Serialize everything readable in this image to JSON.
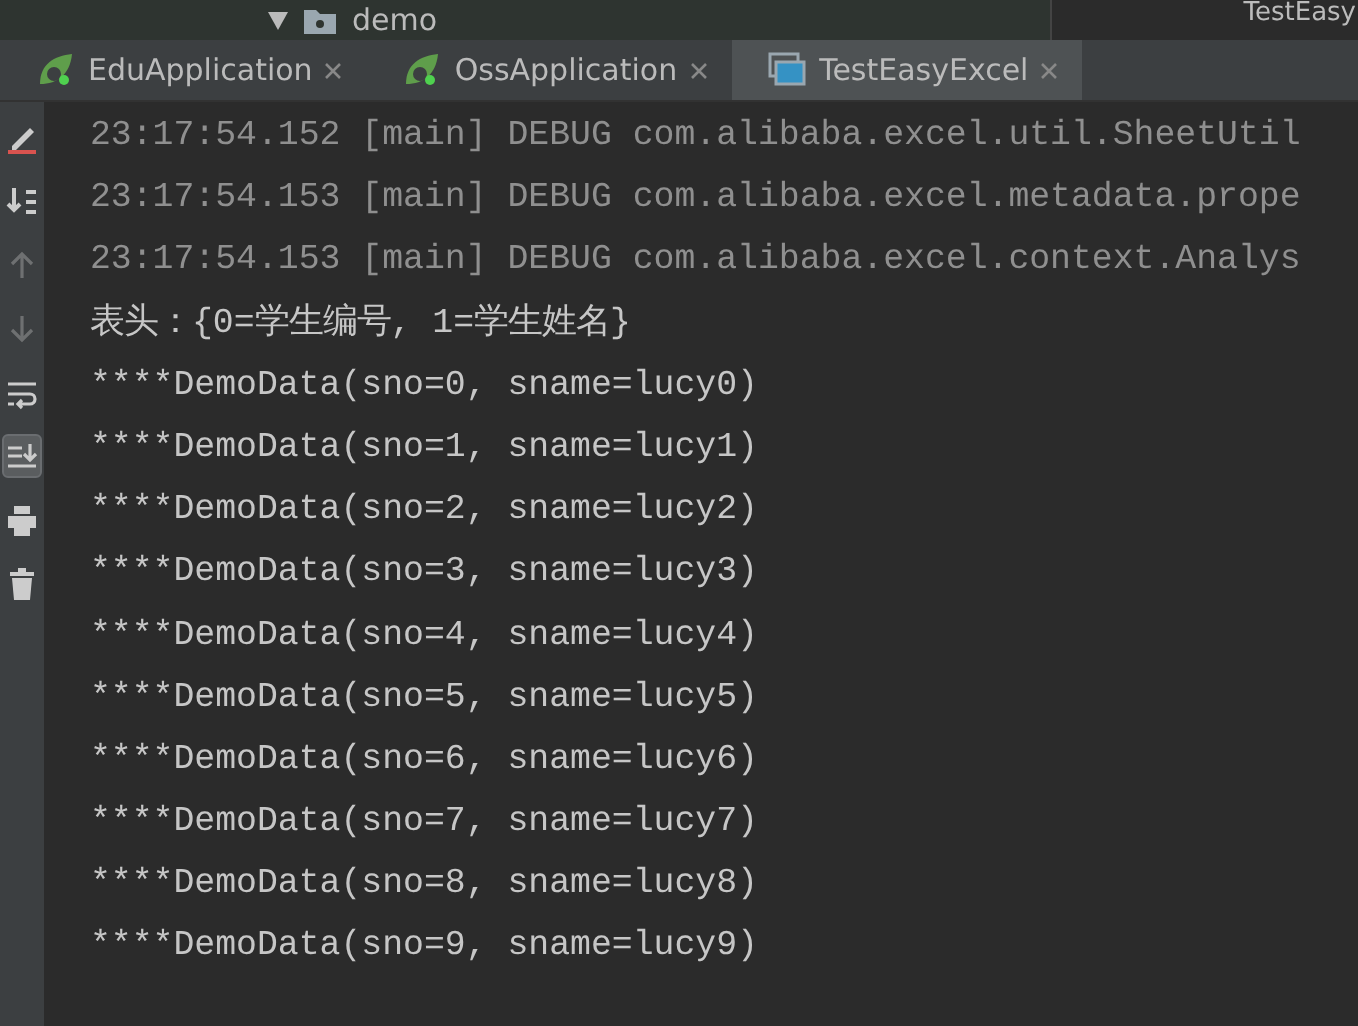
{
  "project_tree": {
    "folder": "demo",
    "expanded": true
  },
  "top_right_title": "TestEasy",
  "tabs": [
    {
      "label": "EduApplication",
      "kind": "spring",
      "selected": false
    },
    {
      "label": "OssApplication",
      "kind": "spring",
      "selected": false
    },
    {
      "label": "TestEasyExcel",
      "kind": "window",
      "selected": true
    }
  ],
  "toolbar": [
    {
      "kind": "edit",
      "selected": false,
      "disabled": false
    },
    {
      "kind": "sort",
      "selected": false,
      "disabled": false
    },
    {
      "kind": "up",
      "selected": false,
      "disabled": true
    },
    {
      "kind": "down",
      "selected": false,
      "disabled": true
    },
    {
      "kind": "wrap",
      "selected": false,
      "disabled": false
    },
    {
      "kind": "scroll-end",
      "selected": true,
      "disabled": false
    },
    {
      "kind": "print",
      "selected": false,
      "disabled": false
    },
    {
      "kind": "trash",
      "selected": false,
      "disabled": false
    }
  ],
  "console_lines": [
    {
      "kind": "log",
      "text": "23:17:54.152 [main] DEBUG com.alibaba.excel.util.SheetUtil"
    },
    {
      "kind": "log",
      "text": "23:17:54.153 [main] DEBUG com.alibaba.excel.metadata.prope"
    },
    {
      "kind": "log",
      "text": "23:17:54.153 [main] DEBUG com.alibaba.excel.context.Analys"
    },
    {
      "kind": "output",
      "text": "表头：{0=学生编号, 1=学生姓名}"
    },
    {
      "kind": "output",
      "text": "****DemoData(sno=0, sname=lucy0)"
    },
    {
      "kind": "output",
      "text": "****DemoData(sno=1, sname=lucy1)"
    },
    {
      "kind": "output",
      "text": "****DemoData(sno=2, sname=lucy2)"
    },
    {
      "kind": "output",
      "text": "****DemoData(sno=3, sname=lucy3)"
    },
    {
      "kind": "output",
      "text": "****DemoData(sno=4, sname=lucy4)"
    },
    {
      "kind": "output",
      "text": "****DemoData(sno=5, sname=lucy5)"
    },
    {
      "kind": "output",
      "text": "****DemoData(sno=6, sname=lucy6)"
    },
    {
      "kind": "output",
      "text": "****DemoData(sno=7, sname=lucy7)"
    },
    {
      "kind": "output",
      "text": "****DemoData(sno=8, sname=lucy8)"
    },
    {
      "kind": "output",
      "text": "****DemoData(sno=9, sname=lucy9)"
    }
  ]
}
